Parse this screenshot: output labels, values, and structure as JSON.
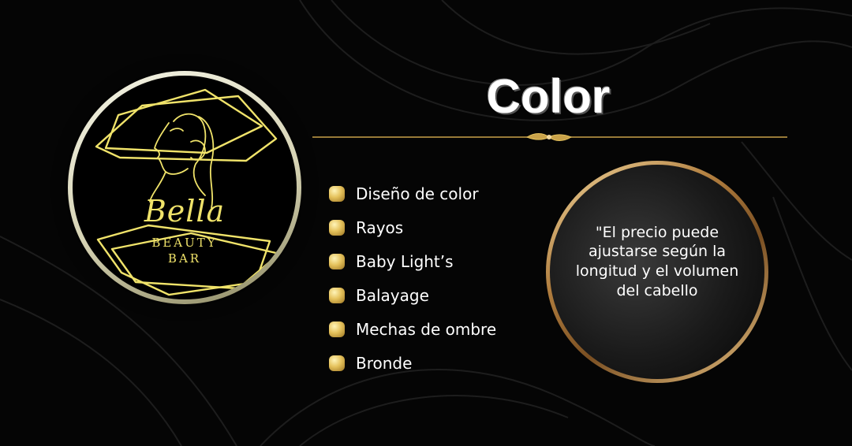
{
  "brand": {
    "script_name": "Bella",
    "line1": "BEAUTY",
    "line2": "BAR"
  },
  "title": "Color",
  "services": [
    "Diseño de color",
    "Rayos",
    "Baby Light’s",
    "Balayage",
    "Mechas de ombre",
    "Bronde"
  ],
  "note": "\"El precio puede ajustarse según la longitud y el volumen del cabello",
  "colors": {
    "background": "#050505",
    "gold": "#e5c25c",
    "logo_line": "#f0e36a",
    "text": "#ffffff"
  }
}
